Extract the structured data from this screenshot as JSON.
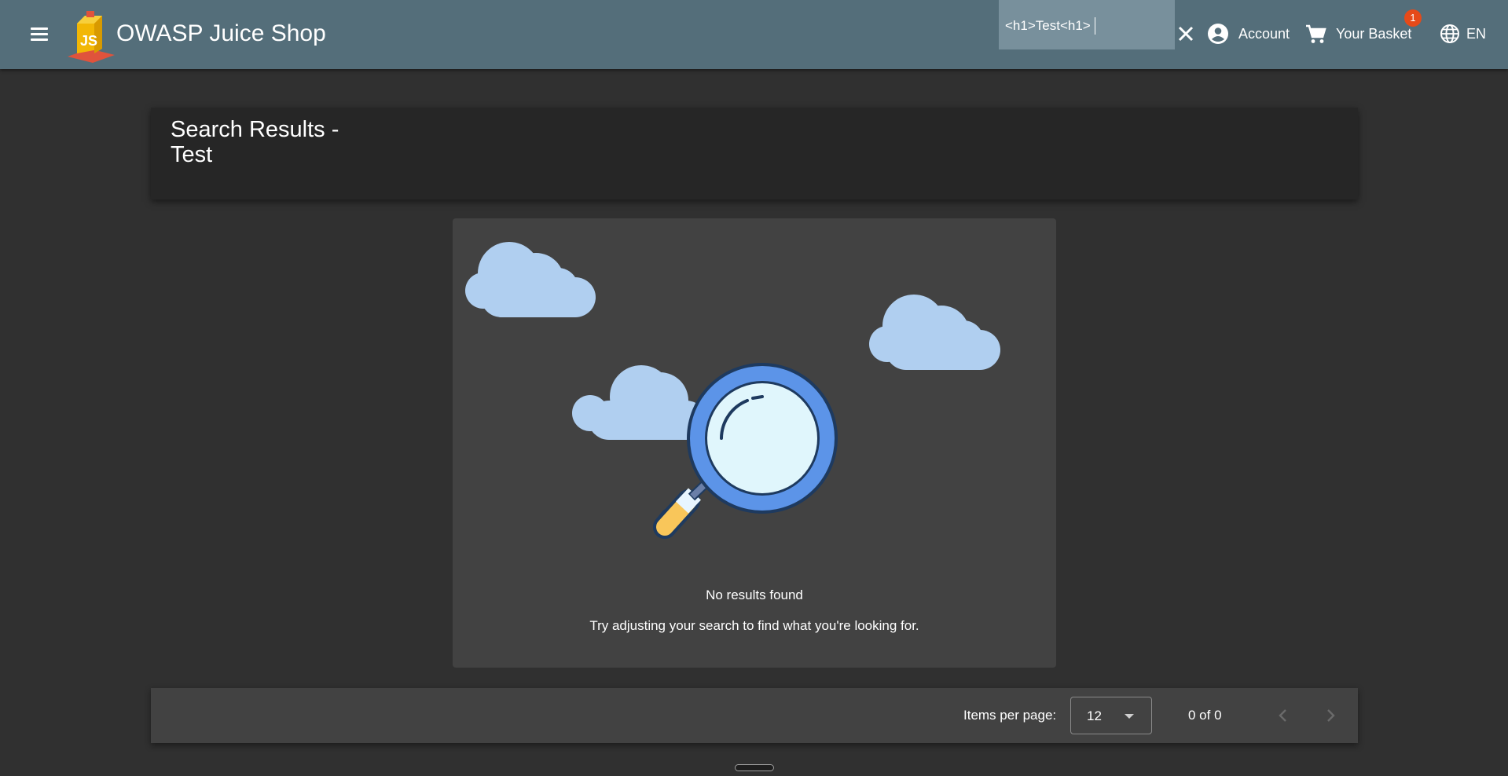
{
  "header": {
    "app_title": "OWASP Juice Shop",
    "search_value": "<h1>Test<h1>",
    "account_label": "Account",
    "basket_label": "Your Basket",
    "basket_count": "1",
    "language_label": "EN",
    "icons": [
      "menu-icon",
      "juice-shop-logo",
      "close-icon",
      "account-circle-icon",
      "shopping-cart-icon",
      "language-icon"
    ],
    "colors": {
      "toolbar": "#546e7a",
      "search": "#78909c",
      "badge": "#e64a19"
    }
  },
  "results": {
    "heading": "Search Results - Test",
    "empty_title": "No results found",
    "empty_subtitle": "Try adjusting your search to find what you're looking for."
  },
  "paginator": {
    "items_per_page_label": "Items per page:",
    "items_per_page_value": "12",
    "range_label": "0 of 0",
    "icons": [
      "chevron-left-icon",
      "chevron-right-icon"
    ]
  }
}
